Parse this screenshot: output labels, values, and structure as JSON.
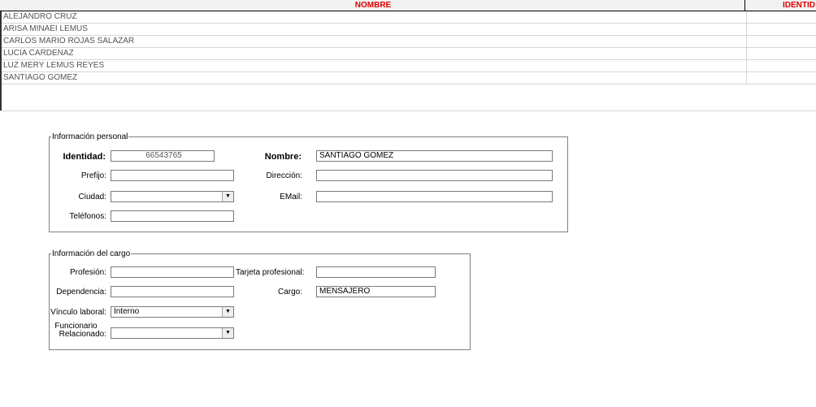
{
  "grid": {
    "headers": {
      "name": "NOMBRE",
      "id": "IDENTID"
    },
    "rows": [
      {
        "name": "ALEJANDRO CRUZ"
      },
      {
        "name": "ARISA MINAEI LEMUS"
      },
      {
        "name": "CARLOS MARIO ROJAS SALAZAR"
      },
      {
        "name": "LUCIA CARDENAZ"
      },
      {
        "name": "LUZ MERY LEMUS REYES"
      },
      {
        "name": "SANTIAGO GOMEZ"
      }
    ]
  },
  "personal": {
    "legend": "Información personal",
    "identidad_label": "Identidad:",
    "identidad_value": "66543765",
    "nombre_label": "Nombre:",
    "nombre_value": "SANTIAGO GOMEZ",
    "prefijo_label": "Prefijo:",
    "prefijo_value": "",
    "direccion_label": "Dirección:",
    "direccion_value": "",
    "ciudad_label": "Ciudad:",
    "ciudad_value": "",
    "email_label": "EMail:",
    "email_value": "",
    "telefonos_label": "Teléfonos:",
    "telefonos_value": ""
  },
  "cargo": {
    "legend": "Información del cargo",
    "profesion_label": "Profesión:",
    "profesion_value": "",
    "tarjeta_label": "Tarjeta profesional:",
    "tarjeta_value": "",
    "dependencia_label": "Dependencia:",
    "dependencia_value": "",
    "cargo_label": "Cargo:",
    "cargo_value": "MENSAJERO",
    "vinculo_label": "Vínculo laboral:",
    "vinculo_value": "Interno",
    "funcionario_label_1": "Funcionario",
    "funcionario_label_2": "Relacionado:",
    "funcionario_value": ""
  }
}
